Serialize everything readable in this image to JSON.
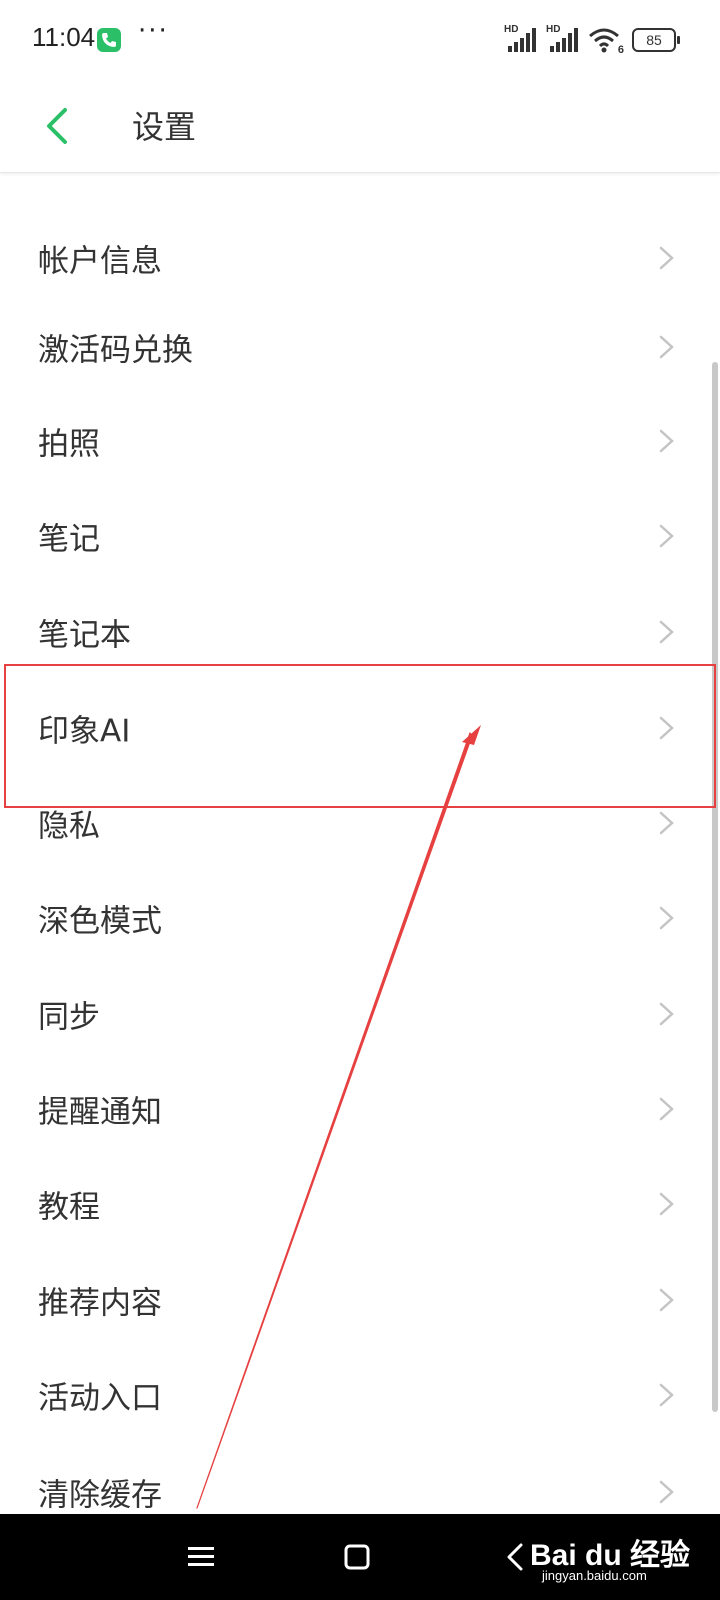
{
  "status_bar": {
    "time": "11:04",
    "dots": "···",
    "signal_1_label": "HD",
    "signal_2_label": "HD",
    "wifi_label": "6",
    "battery": "85"
  },
  "header": {
    "title": "设置"
  },
  "settings_list": [
    {
      "label": "帐户信息"
    },
    {
      "label": "激活码兑换"
    },
    {
      "label": "拍照"
    },
    {
      "label": "笔记"
    },
    {
      "label": "笔记本"
    },
    {
      "label": "印象AI"
    },
    {
      "label": "隐私"
    },
    {
      "label": "深色模式"
    },
    {
      "label": "同步"
    },
    {
      "label": "提醒通知"
    },
    {
      "label": "教程"
    },
    {
      "label": "推荐内容"
    },
    {
      "label": "活动入口"
    },
    {
      "label": "清除缓存"
    }
  ],
  "watermark": {
    "brand": "Bai du 经验",
    "url": "jingyan.baidu.com"
  },
  "colors": {
    "accent": "#2bbf68",
    "annotation": "#e64040"
  }
}
